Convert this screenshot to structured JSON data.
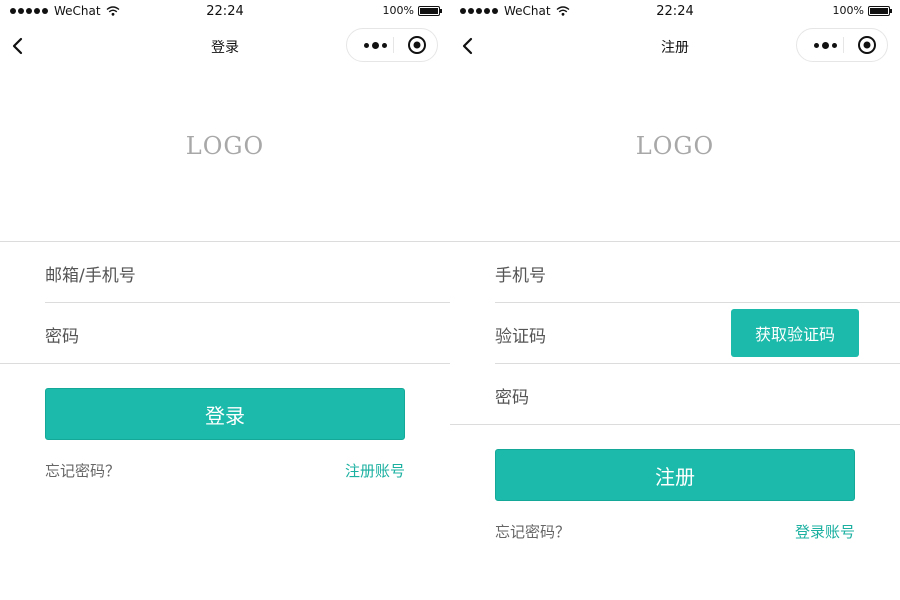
{
  "status_bar": {
    "carrier": "WeChat",
    "time": "22:24",
    "battery_text": "100%",
    "battery_level": 1.0
  },
  "login": {
    "nav_title": "登录",
    "logo_text": "LOGO",
    "account_placeholder": "邮箱/手机号",
    "password_placeholder": "密码",
    "submit_label": "登录",
    "forgot_label": "忘记密码？",
    "switch_label": "注册账号"
  },
  "register": {
    "nav_title": "注册",
    "logo_text": "LOGO",
    "phone_placeholder": "手机号",
    "code_placeholder": "验证码",
    "get_code_label": "获取验证码",
    "password_placeholder": "密码",
    "submit_label": "注册",
    "forgot_label": "忘记密码？",
    "switch_label": "登录账号"
  },
  "colors": {
    "accent": "#1bbaaa",
    "link": "#1bb0a0",
    "divider": "#dcdcdc"
  }
}
